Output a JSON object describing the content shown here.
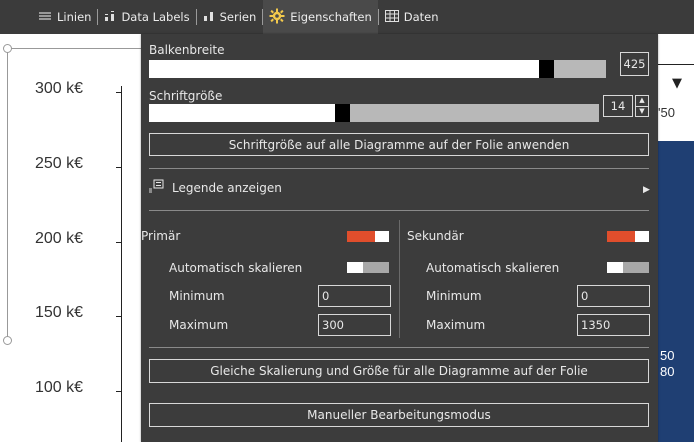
{
  "toolbar": {
    "items": [
      {
        "label": "Linien",
        "icon": "lines-icon"
      },
      {
        "label": "Data Labels",
        "icon": "data-labels-icon"
      },
      {
        "label": "Serien",
        "icon": "series-icon"
      },
      {
        "label": "Eigenschaften",
        "icon": "gear-icon"
      },
      {
        "label": "Daten",
        "icon": "table-icon"
      }
    ]
  },
  "chart": {
    "y_ticks": [
      "300 k€",
      "250 k€",
      "200 k€",
      "150 k€",
      "100 k€"
    ],
    "right_labels": [
      "'50",
      "50",
      "80"
    ]
  },
  "panel": {
    "bar_width": {
      "label": "Balkenbreite",
      "value": "425",
      "fraction": 0.87
    },
    "font_size": {
      "label": "Schriftgröße",
      "value": "14",
      "fraction": 0.43
    },
    "apply_font_button": "Schriftgröße auf alle Diagramme auf der Folie anwenden",
    "legend_label": "Legende anzeigen",
    "primary": {
      "label": "Primär",
      "auto_scale_label": "Automatisch skalieren",
      "min_label": "Minimum",
      "min_value": "0",
      "max_label": "Maximum",
      "max_value": "300"
    },
    "secondary": {
      "label": "Sekundär",
      "auto_scale_label": "Automatisch skalieren",
      "min_label": "Minimum",
      "min_value": "0",
      "max_label": "Maximum",
      "max_value": "1350"
    },
    "same_scale_button": "Gleiche Skalierung und Größe für alle Diagramme auf der Folie",
    "manual_edit_button": "Manueller Bearbeitungsmodus"
  },
  "colors": {
    "panel_bg": "#3c3c3c",
    "toolbar_bg": "#3b3b3b",
    "accent_red": "#e04e2c",
    "chart_bar_navy": "#1f3f73"
  }
}
